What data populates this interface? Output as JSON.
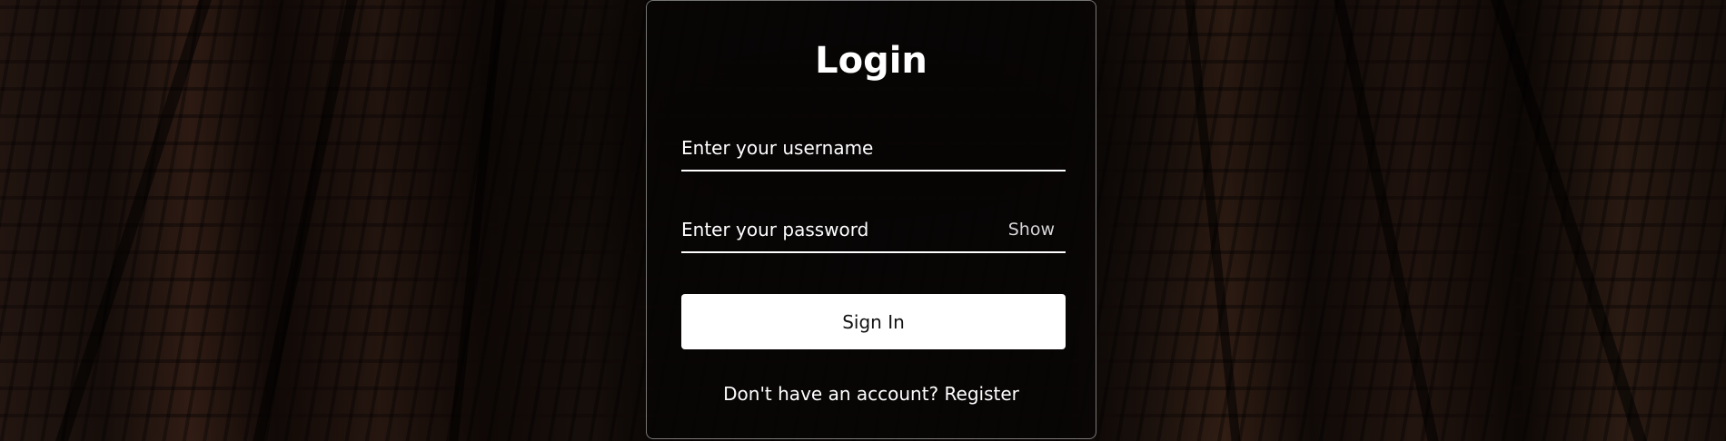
{
  "background": {
    "description_icon": "library-bookshelves-image"
  },
  "login": {
    "title": "Login",
    "username_placeholder": "Enter your username",
    "username_value": "",
    "password_placeholder": "Enter your password",
    "password_value": "",
    "show_label": "Show",
    "signin_label": "Sign In",
    "register_prompt": "Don't have an account?",
    "register_link": "Register"
  },
  "colors": {
    "card_border": "#ffffff",
    "button_bg": "#ffffff",
    "button_text": "#111111",
    "text": "#ffffff",
    "show_text": "#d6d6d6"
  }
}
